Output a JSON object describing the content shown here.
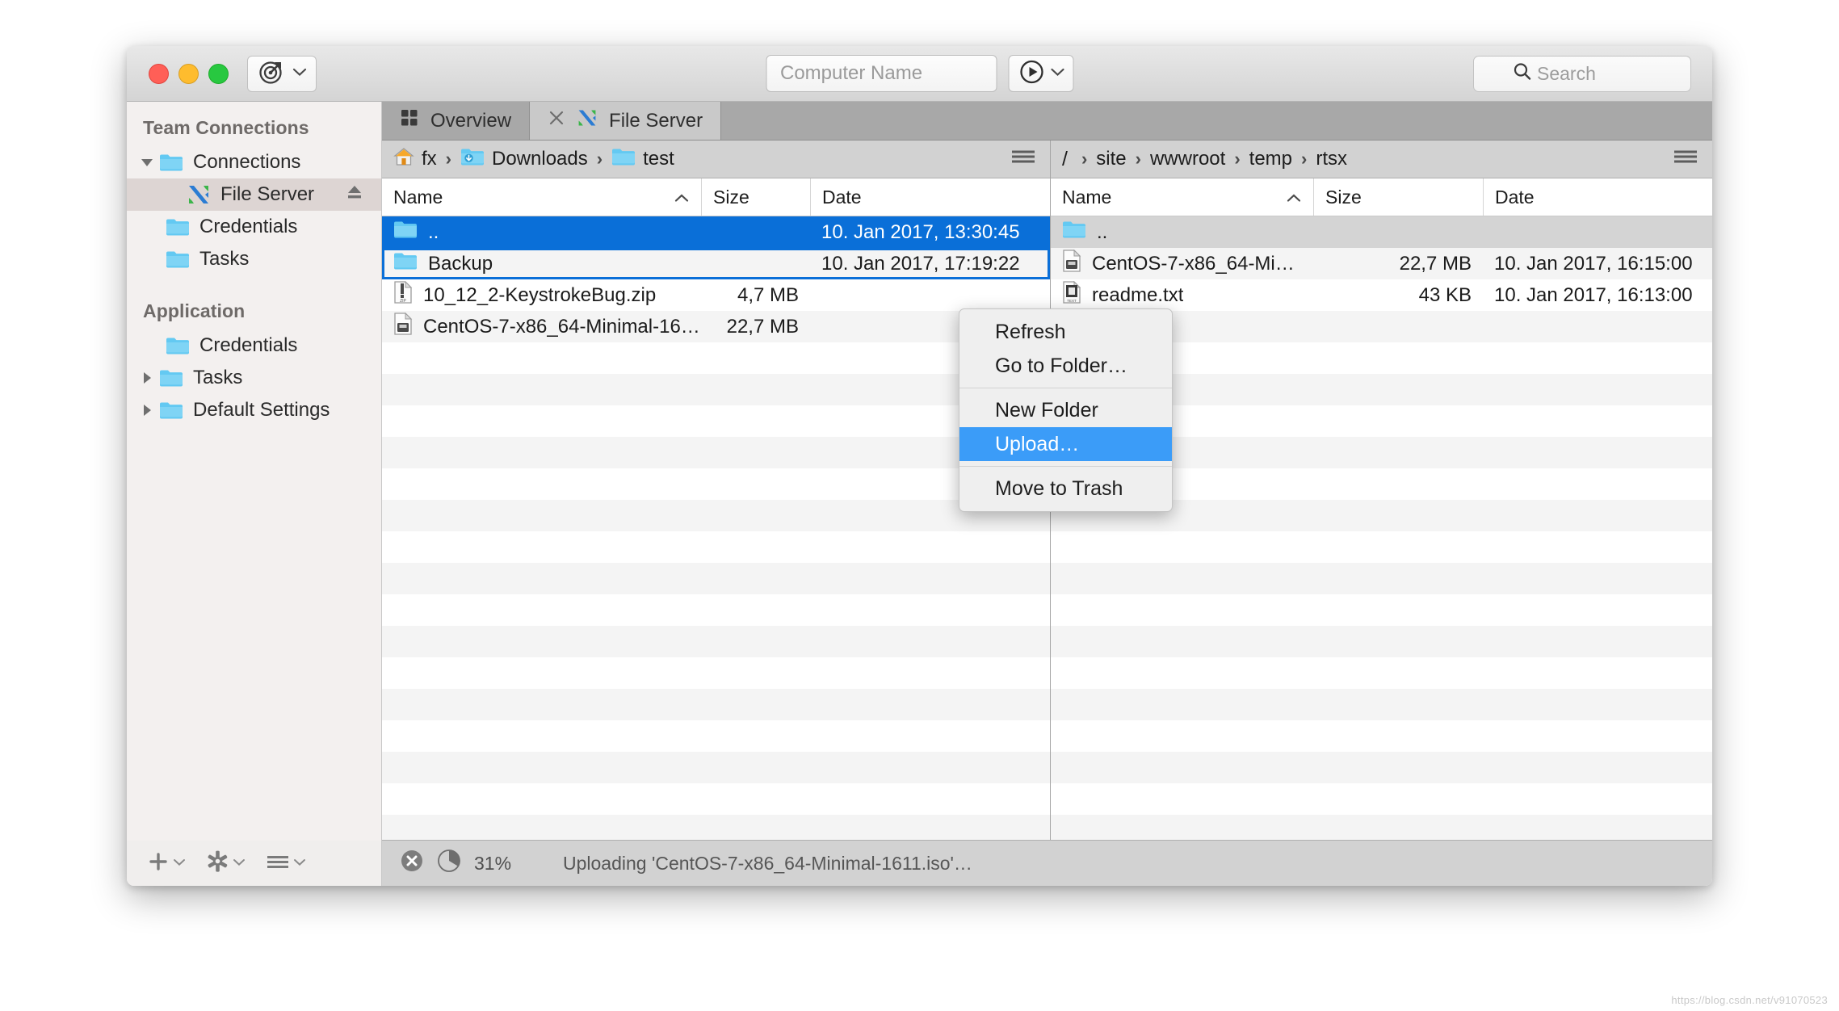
{
  "window": {
    "traffic_lights": [
      "close",
      "minimize",
      "maximize"
    ],
    "target_button_icon": "target-icon"
  },
  "toolbar": {
    "computer_name_value": "",
    "computer_name_placeholder": "Computer Name",
    "connect_icon": "play-circle-icon",
    "search_value": "",
    "search_placeholder": "Search"
  },
  "sidebar": {
    "groups": [
      {
        "title": "Team Connections",
        "items": [
          {
            "label": "Connections",
            "icon": "folder-icon",
            "disclosure": "down",
            "indent": 0,
            "selected": false
          },
          {
            "label": "File Server",
            "icon": "app-icon",
            "disclosure": "",
            "indent": 1,
            "selected": true,
            "accessory": "eject-icon"
          },
          {
            "label": "Credentials",
            "icon": "folder-icon",
            "disclosure": "",
            "indent": 0,
            "selected": false
          },
          {
            "label": "Tasks",
            "icon": "folder-icon",
            "disclosure": "",
            "indent": 0,
            "selected": false
          }
        ]
      },
      {
        "title": "Application",
        "items": [
          {
            "label": "Credentials",
            "icon": "folder-icon",
            "disclosure": "",
            "indent": 0,
            "selected": false
          },
          {
            "label": "Tasks",
            "icon": "folder-icon",
            "disclosure": "right",
            "indent": 0,
            "selected": false
          },
          {
            "label": "Default Settings",
            "icon": "folder-icon",
            "disclosure": "right",
            "indent": 0,
            "selected": false
          }
        ]
      }
    ],
    "footer": [
      {
        "name": "add-button",
        "icon": "plus-icon"
      },
      {
        "name": "settings-button",
        "icon": "gear-icon"
      },
      {
        "name": "actions-button",
        "icon": "hamburger-icon"
      }
    ]
  },
  "tabs": [
    {
      "label": "Overview",
      "icon": "grid-icon",
      "active": false,
      "closable": false
    },
    {
      "label": "File Server",
      "icon": "app-icon",
      "active": true,
      "closable": true
    }
  ],
  "left_pane": {
    "breadcrumb": [
      {
        "label": "fx",
        "icon": "home-icon"
      },
      {
        "label": "Downloads",
        "icon": "downloads-folder-icon"
      },
      {
        "label": "test",
        "icon": "folder-icon"
      }
    ],
    "columns": [
      "Name",
      "Size",
      "Date"
    ],
    "sort_column": "Name",
    "sort_direction": "asc",
    "rows": [
      {
        "name": "..",
        "icon": "folder-icon",
        "size": "",
        "date": "10. Jan 2017, 13:30:45",
        "state": "selected"
      },
      {
        "name": "Backup",
        "icon": "folder-icon",
        "size": "",
        "date": "10. Jan 2017, 17:19:22",
        "state": "focused"
      },
      {
        "name": "10_12_2-KeystrokeBug.zip",
        "icon": "zip-icon",
        "size": "4,7 MB",
        "date": "",
        "state": "normal"
      },
      {
        "name": "CentOS-7-x86_64-Minimal-161…",
        "icon": "disk-icon",
        "size": "22,7 MB",
        "date": "",
        "state": "normal"
      }
    ]
  },
  "right_pane": {
    "breadcrumb_root": "/",
    "breadcrumb": [
      {
        "label": "site"
      },
      {
        "label": "wwwroot"
      },
      {
        "label": "temp"
      },
      {
        "label": "rtsx"
      }
    ],
    "columns": [
      "Name",
      "Size",
      "Date"
    ],
    "sort_column": "Name",
    "sort_direction": "asc",
    "rows": [
      {
        "name": "..",
        "icon": "folder-icon",
        "size": "",
        "date": "",
        "state": "grey"
      },
      {
        "name": "CentOS-7-x86_64-Mi…",
        "icon": "disk-icon",
        "size": "22,7 MB",
        "date": "10. Jan 2017, 16:15:00",
        "state": "normal"
      },
      {
        "name": "readme.txt",
        "icon": "text-icon",
        "size": "43 KB",
        "date": "10. Jan 2017, 16:13:00",
        "state": "normal"
      }
    ]
  },
  "context_menu": {
    "items": [
      {
        "label": "Refresh",
        "highlighted": false,
        "separator_after": false
      },
      {
        "label": "Go to Folder…",
        "highlighted": false,
        "separator_after": true
      },
      {
        "label": "New Folder",
        "highlighted": false,
        "separator_after": false
      },
      {
        "label": "Upload…",
        "highlighted": true,
        "separator_after": true
      },
      {
        "label": "Move to Trash",
        "highlighted": false,
        "separator_after": false
      }
    ]
  },
  "statusbar": {
    "cancel_icon": "cancel-circle-icon",
    "progress_percent": 31,
    "percent_label": "31%",
    "message": "Uploading 'CentOS-7-x86_64-Minimal-1611.iso'…"
  },
  "watermark": "https://blog.csdn.net/v91070523",
  "colors": {
    "selection_blue": "#0a6fd8",
    "menu_highlight_blue": "#3b9cf8",
    "sidebar_bg": "#f3f0ef",
    "tabbar_bg": "#a8a8a8"
  }
}
